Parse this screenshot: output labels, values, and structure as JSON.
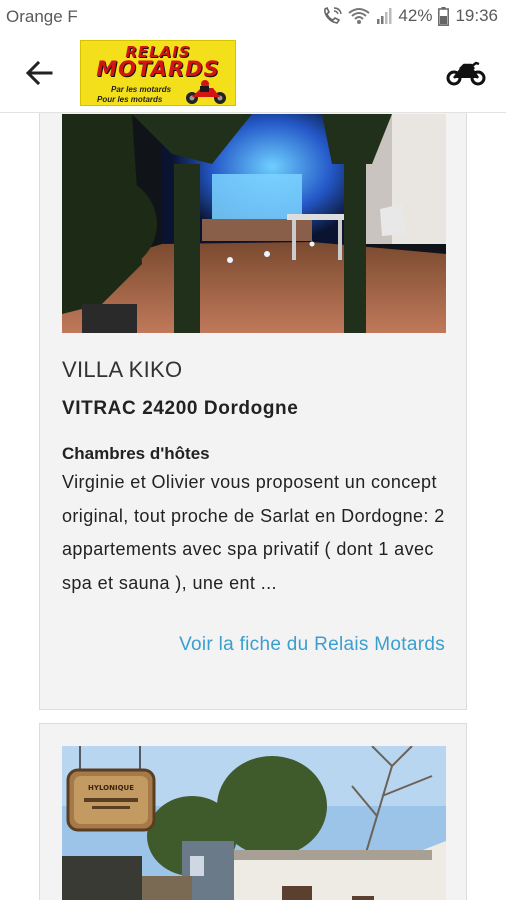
{
  "status_bar": {
    "carrier": "Orange F",
    "battery": "42%",
    "time": "19:36"
  },
  "app_bar": {
    "logo": {
      "line1": "RELAIS",
      "line2": "MOTARDS",
      "tagline1": "Par les motards",
      "tagline2": "Pour les motards"
    }
  },
  "listings": [
    {
      "name": "VILLA KIKO",
      "location": "VITRAC 24200 Dordogne",
      "type": "Chambres d'hôtes",
      "description": "Virginie et Olivier vous proposent un concept original, tout proche de Sarlat en Dordogne: 2 appartements avec spa privatif ( dont 1 avec spa et sauna ), une ent ...",
      "link_label": "Voir la fiche du Relais Motards"
    },
    {
      "name": "",
      "sign_text": "HYLONIQUE"
    }
  ],
  "colors": {
    "link": "#3a9fcf",
    "logo_bg": "#f3e01b",
    "logo_text": "#d21414",
    "card_bg": "#f3f3f3"
  },
  "icons": [
    "back-arrow-icon",
    "motorcycle-icon",
    "call-wifi-icon",
    "wifi-icon",
    "signal-icon",
    "battery-icon"
  ]
}
